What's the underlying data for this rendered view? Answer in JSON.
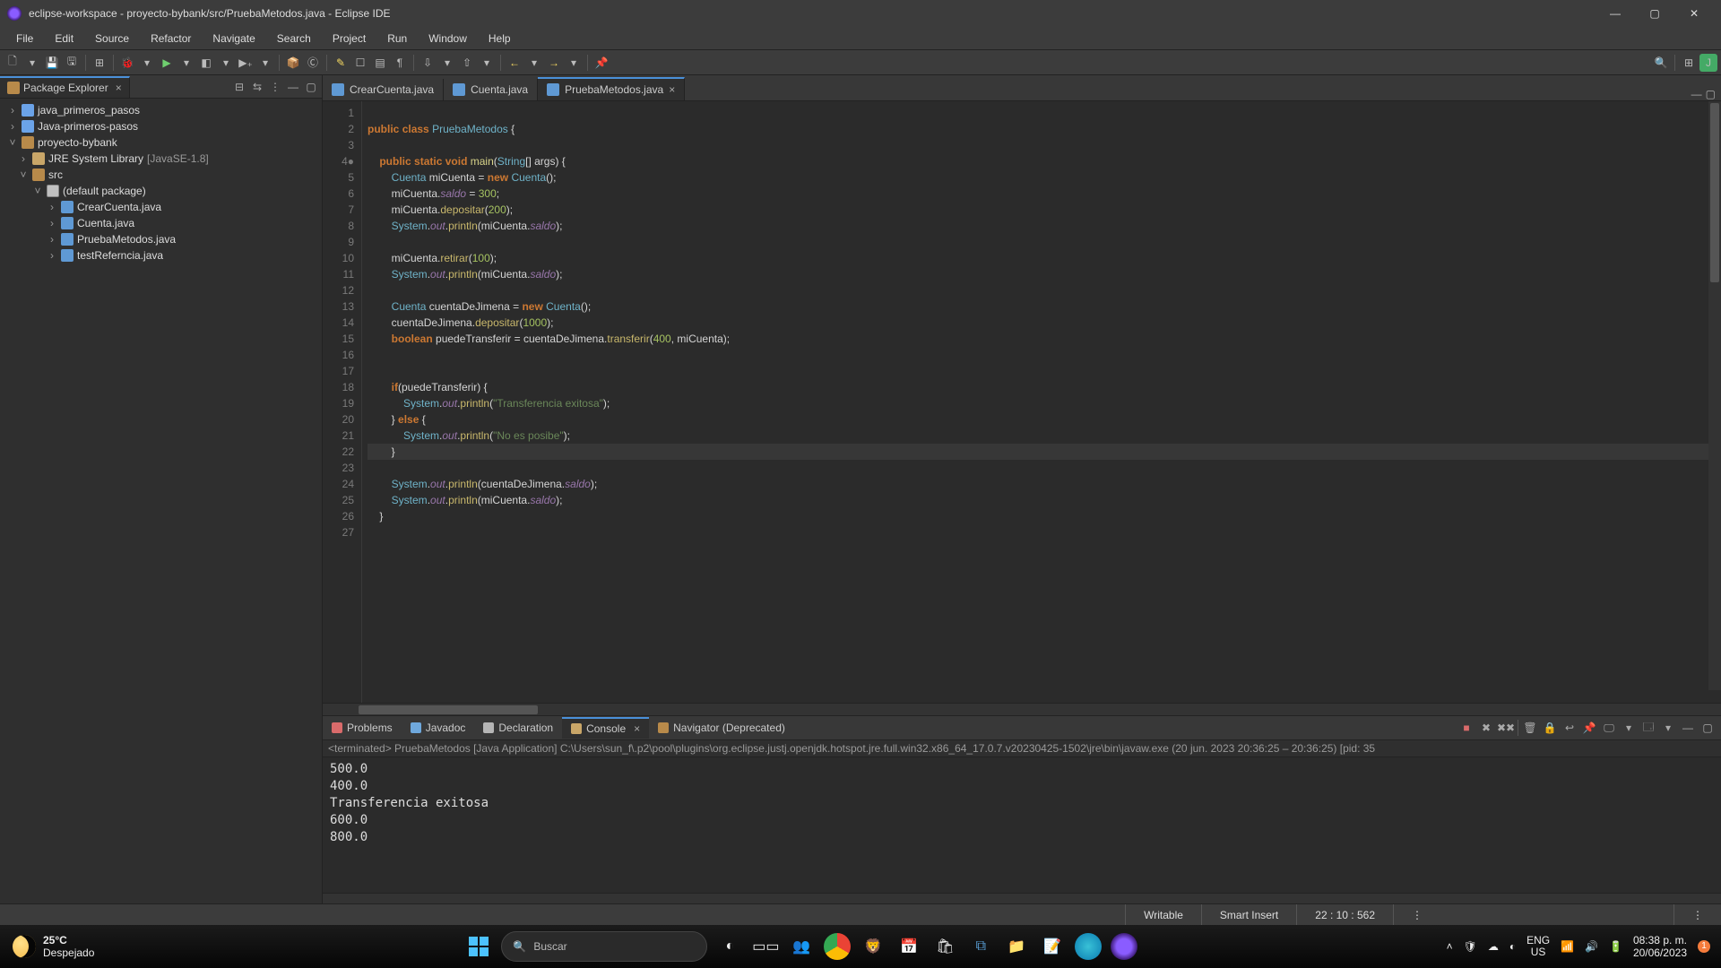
{
  "titlebar": {
    "title": "eclipse-workspace - proyecto-bybank/src/PruebaMetodos.java - Eclipse IDE"
  },
  "menu": [
    "File",
    "Edit",
    "Source",
    "Refactor",
    "Navigate",
    "Search",
    "Project",
    "Run",
    "Window",
    "Help"
  ],
  "package_explorer": {
    "title": "Package Explorer",
    "items": [
      {
        "level": 0,
        "twisty": "›",
        "icon": "proj",
        "label": "java_primeros_pasos"
      },
      {
        "level": 0,
        "twisty": "›",
        "icon": "proj",
        "label": "Java-primeros-pasos"
      },
      {
        "level": 0,
        "twisty": "˅",
        "icon": "proj-open",
        "label": "proyecto-bybank"
      },
      {
        "level": 1,
        "twisty": "›",
        "icon": "lib",
        "label": "JRE System Library",
        "suffix": " [JavaSE-1.8]"
      },
      {
        "level": 1,
        "twisty": "˅",
        "icon": "pkgsrc",
        "label": "src"
      },
      {
        "level": 2,
        "twisty": "˅",
        "icon": "pkg",
        "label": "(default package)"
      },
      {
        "level": 3,
        "twisty": "›",
        "icon": "java",
        "label": "CrearCuenta.java"
      },
      {
        "level": 3,
        "twisty": "›",
        "icon": "java",
        "label": "Cuenta.java"
      },
      {
        "level": 3,
        "twisty": "›",
        "icon": "java",
        "label": "PruebaMetodos.java"
      },
      {
        "level": 3,
        "twisty": "›",
        "icon": "java",
        "label": "testReferncia.java"
      }
    ]
  },
  "editor_tabs": [
    {
      "label": "CrearCuenta.java",
      "active": false
    },
    {
      "label": "Cuenta.java",
      "active": false
    },
    {
      "label": "PruebaMetodos.java",
      "active": true
    }
  ],
  "code_lines": [
    {
      "n": "1",
      "html": ""
    },
    {
      "n": "2",
      "html": "<span class='kw'>public</span> <span class='kw'>class</span> <span class='type'>PruebaMetodos</span> {"
    },
    {
      "n": "3",
      "html": ""
    },
    {
      "n": "4●",
      "html": "    <span class='kw'>public</span> <span class='kw'>static</span> <span class='kw'>void</span> <span class='fn'>main</span>(<span class='type'>String</span>[] args) {"
    },
    {
      "n": "5",
      "html": "        <span class='type2'>Cuenta</span> miCuenta = <span class='kw'>new</span> <span class='type2'>Cuenta</span>();"
    },
    {
      "n": "6",
      "html": "        miCuenta.<span class='field'>saldo</span> = <span class='num'>300</span>;"
    },
    {
      "n": "7",
      "html": "        miCuenta.<span class='meth'>depositar</span>(<span class='num'>200</span>);"
    },
    {
      "n": "8",
      "html": "        <span class='type2'>System</span>.<span class='field'>out</span>.<span class='meth'>println</span>(miCuenta.<span class='field'>saldo</span>);"
    },
    {
      "n": "9",
      "html": ""
    },
    {
      "n": "10",
      "html": "        miCuenta.<span class='meth'>retirar</span>(<span class='num'>100</span>);"
    },
    {
      "n": "11",
      "html": "        <span class='type2'>System</span>.<span class='field'>out</span>.<span class='meth'>println</span>(miCuenta.<span class='field'>saldo</span>);"
    },
    {
      "n": "12",
      "html": ""
    },
    {
      "n": "13",
      "html": "        <span class='type2'>Cuenta</span> cuentaDeJimena = <span class='kw'>new</span> <span class='type2'>Cuenta</span>();"
    },
    {
      "n": "14",
      "html": "        cuentaDeJimena.<span class='meth'>depositar</span>(<span class='num'>1000</span>);"
    },
    {
      "n": "15",
      "html": "        <span class='kw'>boolean</span> puedeTransferir = cuentaDeJimena.<span class='meth'>transferir</span>(<span class='num'>400</span>, miCuenta);"
    },
    {
      "n": "16",
      "html": ""
    },
    {
      "n": "17",
      "html": ""
    },
    {
      "n": "18",
      "html": "        <span class='kw'>if</span>(puedeTransferir) {"
    },
    {
      "n": "19",
      "html": "            <span class='type2'>System</span>.<span class='field'>out</span>.<span class='meth'>println</span>(<span class='str'>\"Transferencia exitosa\"</span>);"
    },
    {
      "n": "20",
      "html": "        } <span class='kw'>else</span> {"
    },
    {
      "n": "21",
      "html": "            <span class='type2'>System</span>.<span class='field'>out</span>.<span class='meth'>println</span>(<span class='str'>\"No es posibe\"</span>);"
    },
    {
      "n": "22",
      "hl": true,
      "html": "        }"
    },
    {
      "n": "23",
      "html": ""
    },
    {
      "n": "24",
      "html": "        <span class='type2'>System</span>.<span class='field'>out</span>.<span class='meth'>println</span>(cuentaDeJimena.<span class='field'>saldo</span>);"
    },
    {
      "n": "25",
      "html": "        <span class='type2'>System</span>.<span class='field'>out</span>.<span class='meth'>println</span>(miCuenta.<span class='field'>saldo</span>);"
    },
    {
      "n": "26",
      "html": "    }"
    },
    {
      "n": "27",
      "html": ""
    }
  ],
  "bottom_tabs": [
    {
      "label": "Problems",
      "color": "#d96b6b"
    },
    {
      "label": "Javadoc",
      "color": "#6fa8dc"
    },
    {
      "label": "Declaration",
      "color": "#b5b5b5"
    },
    {
      "label": "Console",
      "color": "#c9a668",
      "active": true
    },
    {
      "label": "Navigator (Deprecated)",
      "color": "#b88a4a"
    }
  ],
  "console": {
    "header": "<terminated> PruebaMetodos [Java Application] C:\\Users\\sun_f\\.p2\\pool\\plugins\\org.eclipse.justj.openjdk.hotspot.jre.full.win32.x86_64_17.0.7.v20230425-1502\\jre\\bin\\javaw.exe  (20 jun. 2023 20:36:25 – 20:36:25) [pid: 35",
    "lines": [
      "500.0",
      "400.0",
      "Transferencia exitosa",
      "600.0",
      "800.0"
    ]
  },
  "status": {
    "writable": "Writable",
    "insert": "Smart Insert",
    "pos": "22 : 10 : 562"
  },
  "taskbar": {
    "weather_temp": "25°C",
    "weather_desc": "Despejado",
    "search_placeholder": "Buscar",
    "lang1": "ENG",
    "lang2": "US",
    "time": "08:38 p. m.",
    "date": "20/06/2023",
    "notif": "1"
  }
}
